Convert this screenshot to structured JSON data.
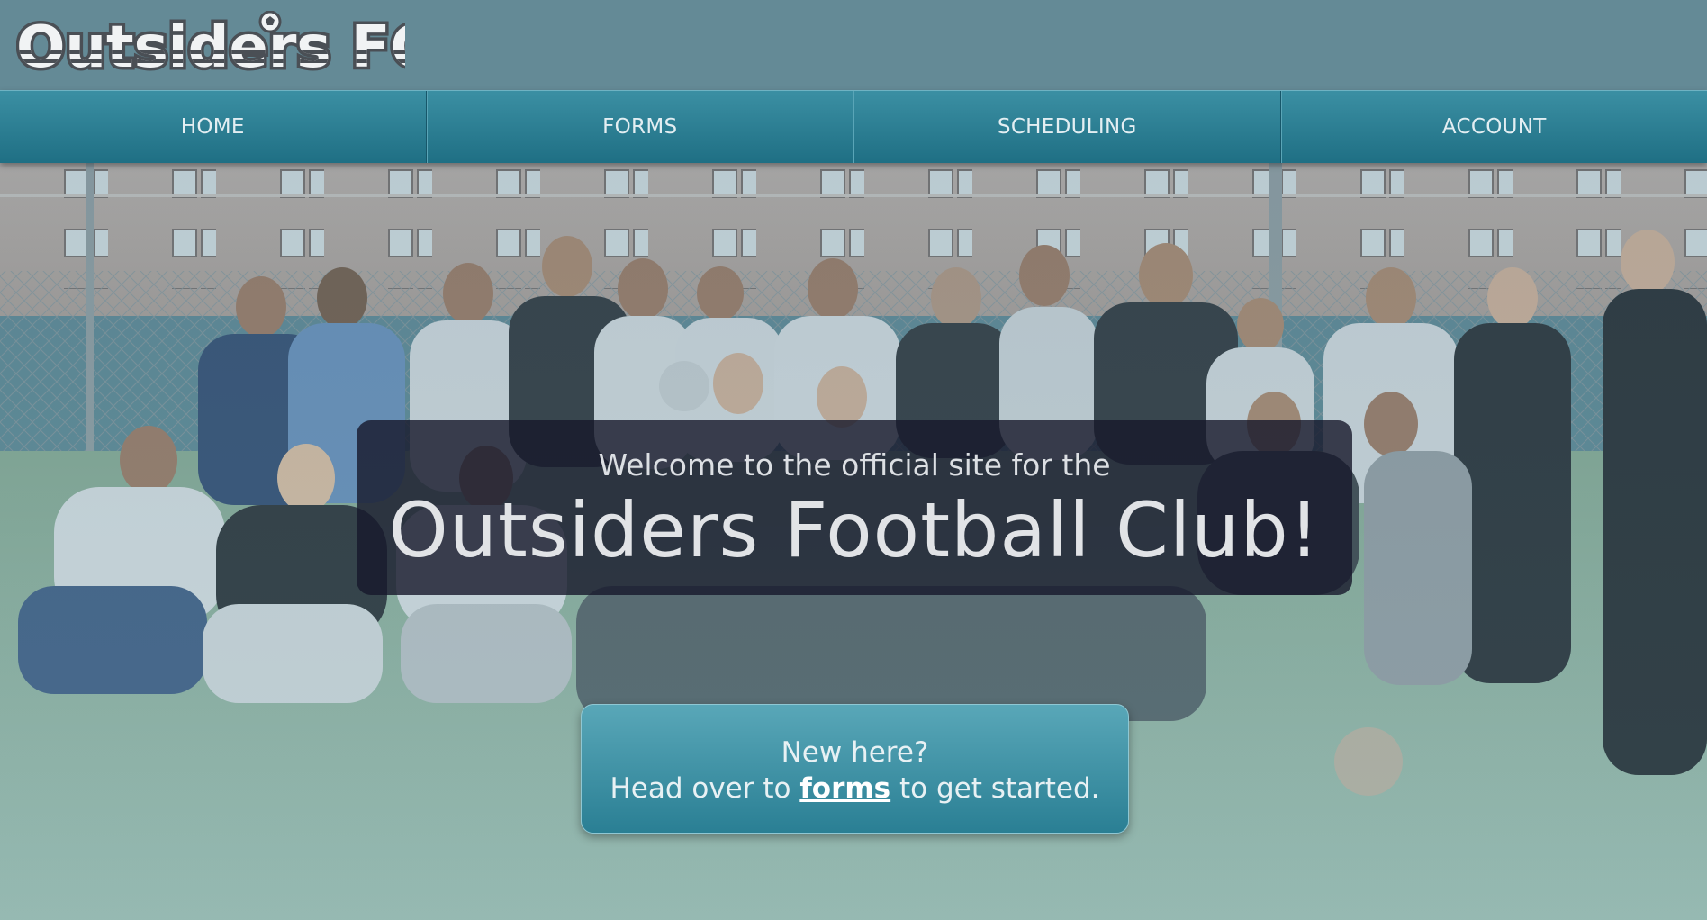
{
  "header": {
    "logo_text": "Outsiders FC"
  },
  "nav": {
    "items": [
      {
        "label": "HOME"
      },
      {
        "label": "FORMS"
      },
      {
        "label": "SCHEDULING"
      },
      {
        "label": "ACCOUNT"
      }
    ]
  },
  "hero": {
    "welcome_line": "Welcome to the official site for the",
    "club_title": "Outsiders Football Club!"
  },
  "cta": {
    "line1": "New here?",
    "line2_prefix": "Head over to ",
    "line2_link": "forms",
    "line2_suffix": " to get started."
  },
  "colors": {
    "header_bg": "#648a96",
    "nav_top": "#3b8fa3",
    "nav_bottom": "#1f6f84",
    "welcome_box": "#16182a",
    "cta_top": "#59a7b8",
    "cta_bottom": "#2a7f94"
  },
  "icons": {
    "logo_ball": "soccer-ball-icon"
  }
}
